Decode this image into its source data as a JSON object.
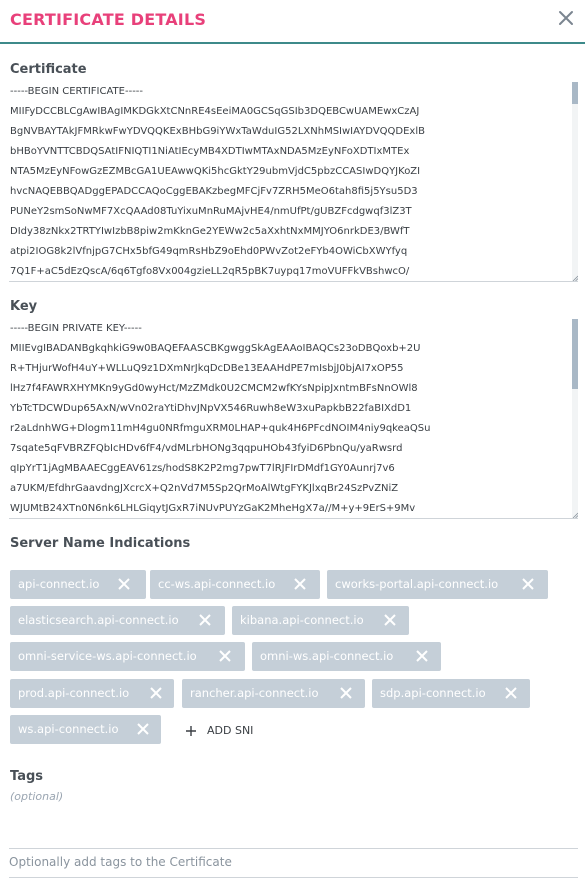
{
  "header": {
    "title": "CERTIFICATE DETAILS"
  },
  "certificate": {
    "label": "Certificate",
    "value": "-----BEGIN CERTIFICATE-----\nMIIFyDCCBLCgAwIBAgIMKDGkXtCNnRE4sEeiMA0GCSqGSIb3DQEBCwUAMEwxCzAJ\nBgNVBAYTAkJFMRkwFwYDVQQKExBHbG9iYWxTaWduIG52LXNhMSIwIAYDVQQDExlB\nbHBoYVNTTCBDQSAtIFNIQTI1NiAtIEcyMB4XDTIwMTAxNDA5MzEyNFoXDTIxMTEx\nNTA5MzEyNFowGzEZMBcGA1UEAwwQKi5hcGktY29ubmVjdC5pbzCCASIwDQYJKoZI\nhvcNAQEBBQADggEPADCCAQoCggEBAKzbegMFCjFv7ZRH5MeO6tah8fi5j5Ysu5D3\nPUNeY2smSoNwMF7XcQAAd08TuYixuMnRuMAjvHE4/nmUfPt/gUBZFcdgwqf3lZ3T\nDIdy38zNkx2TRTYIwIzbB8piw2mKknGe2YEWw2c5aXxhtNxMMJYO6nrkDE3/BWfT\natpi2IOG8k2lVfnjpG7CHx5bfG49qmRsHbZ9oEhd0PWvZot2eFYb4OWiCbXWYfyq\n7Q1F+aC5dEzQscA/6q6Tgfo8Vx004gzieLL2qR5pBK7uypq17moVUFFkVBshwcO/"
  },
  "key": {
    "label": "Key",
    "value": "-----BEGIN PRIVATE KEY-----\nMIIEvgIBADANBgkqhkiG9w0BAQEFAASCBKgwggSkAgEAAoIBAQCs23oDBQoxb+2U\nR+THjurWofH4uY+WLLuQ9z1DXmNrJkqDcDBe13EAAHdPE7mIsbjJ0bjAI7xOP55\nlHz7f4FAWRXHYMKn9yGd0wyHct/MzZMdk0U2CMCM2wfKYsNpipJxntmBFsNnOWl8\nYbTcTDCWDup65AxN/wVn02raYtiDhvJNpVX546Ruwh8eW3xuPapkbB22faBIXdD1\nr2aLdnhWG+Dlogm11mH4gu0NRfmguXRM0LHAP+quk4H6PFcdNOIM4niy9qkeaQSu\n7sqate5qFVBRZFQbIcHDv6fF4/vdMLrbHONg3qqpuHOb43fyiD6PbnQu/yaRwsrd\nqIpYrT1jAgMBAAECggEAV61zs/hodS8K2P2mg7pwT7lRJFIrDMdf1GY0Aunrj7v6\na7UKM/EfdhrGaavdngJXcrcX+Q2nVd7M5Sp2QrMoAlWtgFYKJlxqBr24SzPvZNiZ\nWJUMtB24XTn0N6nk6LHLGiqytJGxR7iNUvPUYzGaK2MheHgX7a//M+y+9ErS+9Mv"
  },
  "sni": {
    "label": "Server Name Indications",
    "items": [
      "api-connect.io",
      "cc-ws.api-connect.io",
      "cworks-portal.api-connect.io",
      "elasticsearch.api-connect.io",
      "kibana.api-connect.io",
      "omni-service-ws.api-connect.io",
      "omni-ws.api-connect.io",
      "prod.api-connect.io",
      "rancher.api-connect.io",
      "sdp.api-connect.io",
      "ws.api-connect.io"
    ],
    "add_label": "ADD SNI"
  },
  "tags": {
    "label": "Tags",
    "optional": "(optional)",
    "placeholder": "Optionally add tags to the Certificate"
  },
  "colors": {
    "title": "#e8407a",
    "accent_rule": "#3d8a8a",
    "chip_bg": "#c5cfd8",
    "scroll_thumb": "#a9b8c6"
  },
  "icons": {
    "close": "close-icon",
    "chip_remove": "x-icon",
    "add": "plus-icon"
  }
}
